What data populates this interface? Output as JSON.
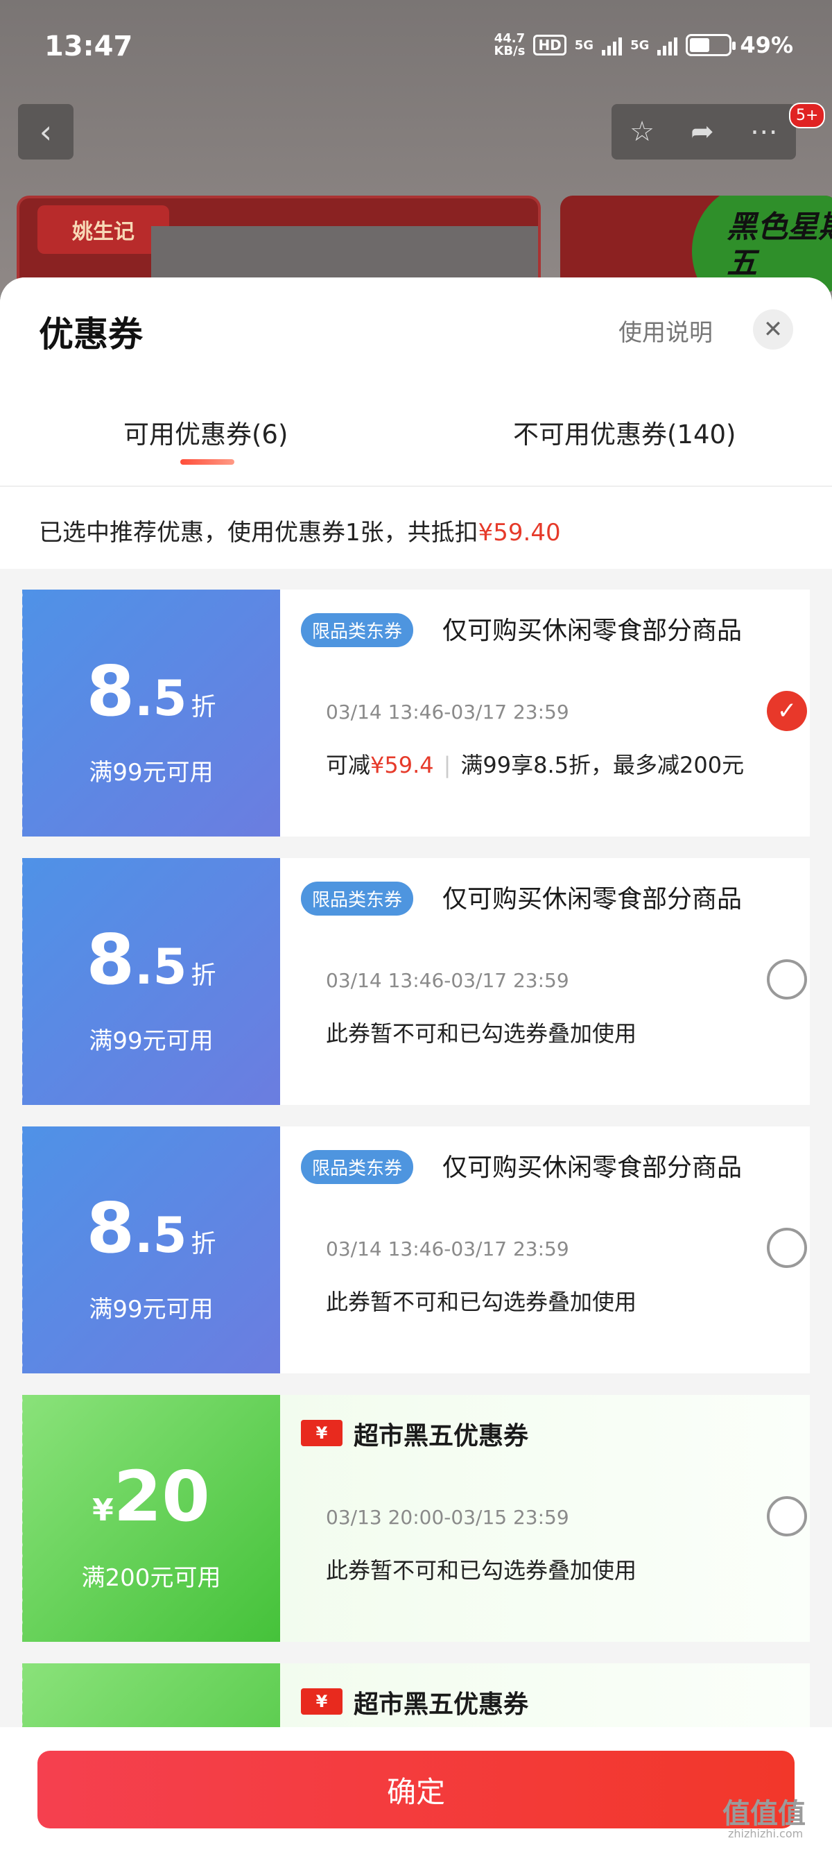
{
  "status": {
    "time": "13:47",
    "net_speed_top": "44.7",
    "net_speed_unit": "KB/s",
    "hd": "HD",
    "net1": "5G",
    "net2": "5G",
    "battery": "49%"
  },
  "nav": {
    "badge": "5+"
  },
  "banner": {
    "logo_text": "姚生记",
    "promo_text": "黑色星期五"
  },
  "sheet": {
    "title": "优惠券",
    "help_label": "使用说明",
    "tabs": [
      {
        "label": "可用优惠券(6)"
      },
      {
        "label": "不可用优惠券(140)"
      }
    ],
    "summary_prefix": "已选中推荐优惠，使用优惠券1张，共抵扣",
    "summary_amount": "¥59.40"
  },
  "coupons": [
    {
      "type": "discount",
      "num": "8",
      "dot": ".5",
      "unit": "折",
      "condition": "满99元可用",
      "tag": "限品类东券",
      "title": "仅可购买休闲零食部分商品",
      "date": "03/14 13:46-03/17 23:59",
      "note_prefix": "可减",
      "note_amount": "¥59.4",
      "note_suffix": "满99享8.5折，最多减200元",
      "selected": true
    },
    {
      "type": "discount",
      "num": "8",
      "dot": ".5",
      "unit": "折",
      "condition": "满99元可用",
      "tag": "限品类东券",
      "title": "仅可购买休闲零食部分商品",
      "date": "03/14 13:46-03/17 23:59",
      "note": "此券暂不可和已勾选券叠加使用",
      "selected": false
    },
    {
      "type": "discount",
      "num": "8",
      "dot": ".5",
      "unit": "折",
      "condition": "满99元可用",
      "tag": "限品类东券",
      "title": "仅可购买休闲零食部分商品",
      "date": "03/14 13:46-03/17 23:59",
      "note": "此券暂不可和已勾选券叠加使用",
      "selected": false
    },
    {
      "type": "cash",
      "yen": "¥",
      "num": "20",
      "condition": "满200元可用",
      "icon": "¥",
      "title": "超市黑五优惠券",
      "date": "03/13 20:00-03/15 23:59",
      "note": "此券暂不可和已勾选券叠加使用",
      "selected": false
    },
    {
      "type": "cash",
      "icon": "¥",
      "title": "超市黑五优惠券"
    }
  ],
  "footer": {
    "confirm_label": "确定"
  },
  "watermark": {
    "text": "值值值",
    "url": "zhizhizhi.com"
  },
  "colors": {
    "accent": "#e8382a",
    "blue_card": "#4f92e7",
    "green_card": "#45c23a"
  }
}
